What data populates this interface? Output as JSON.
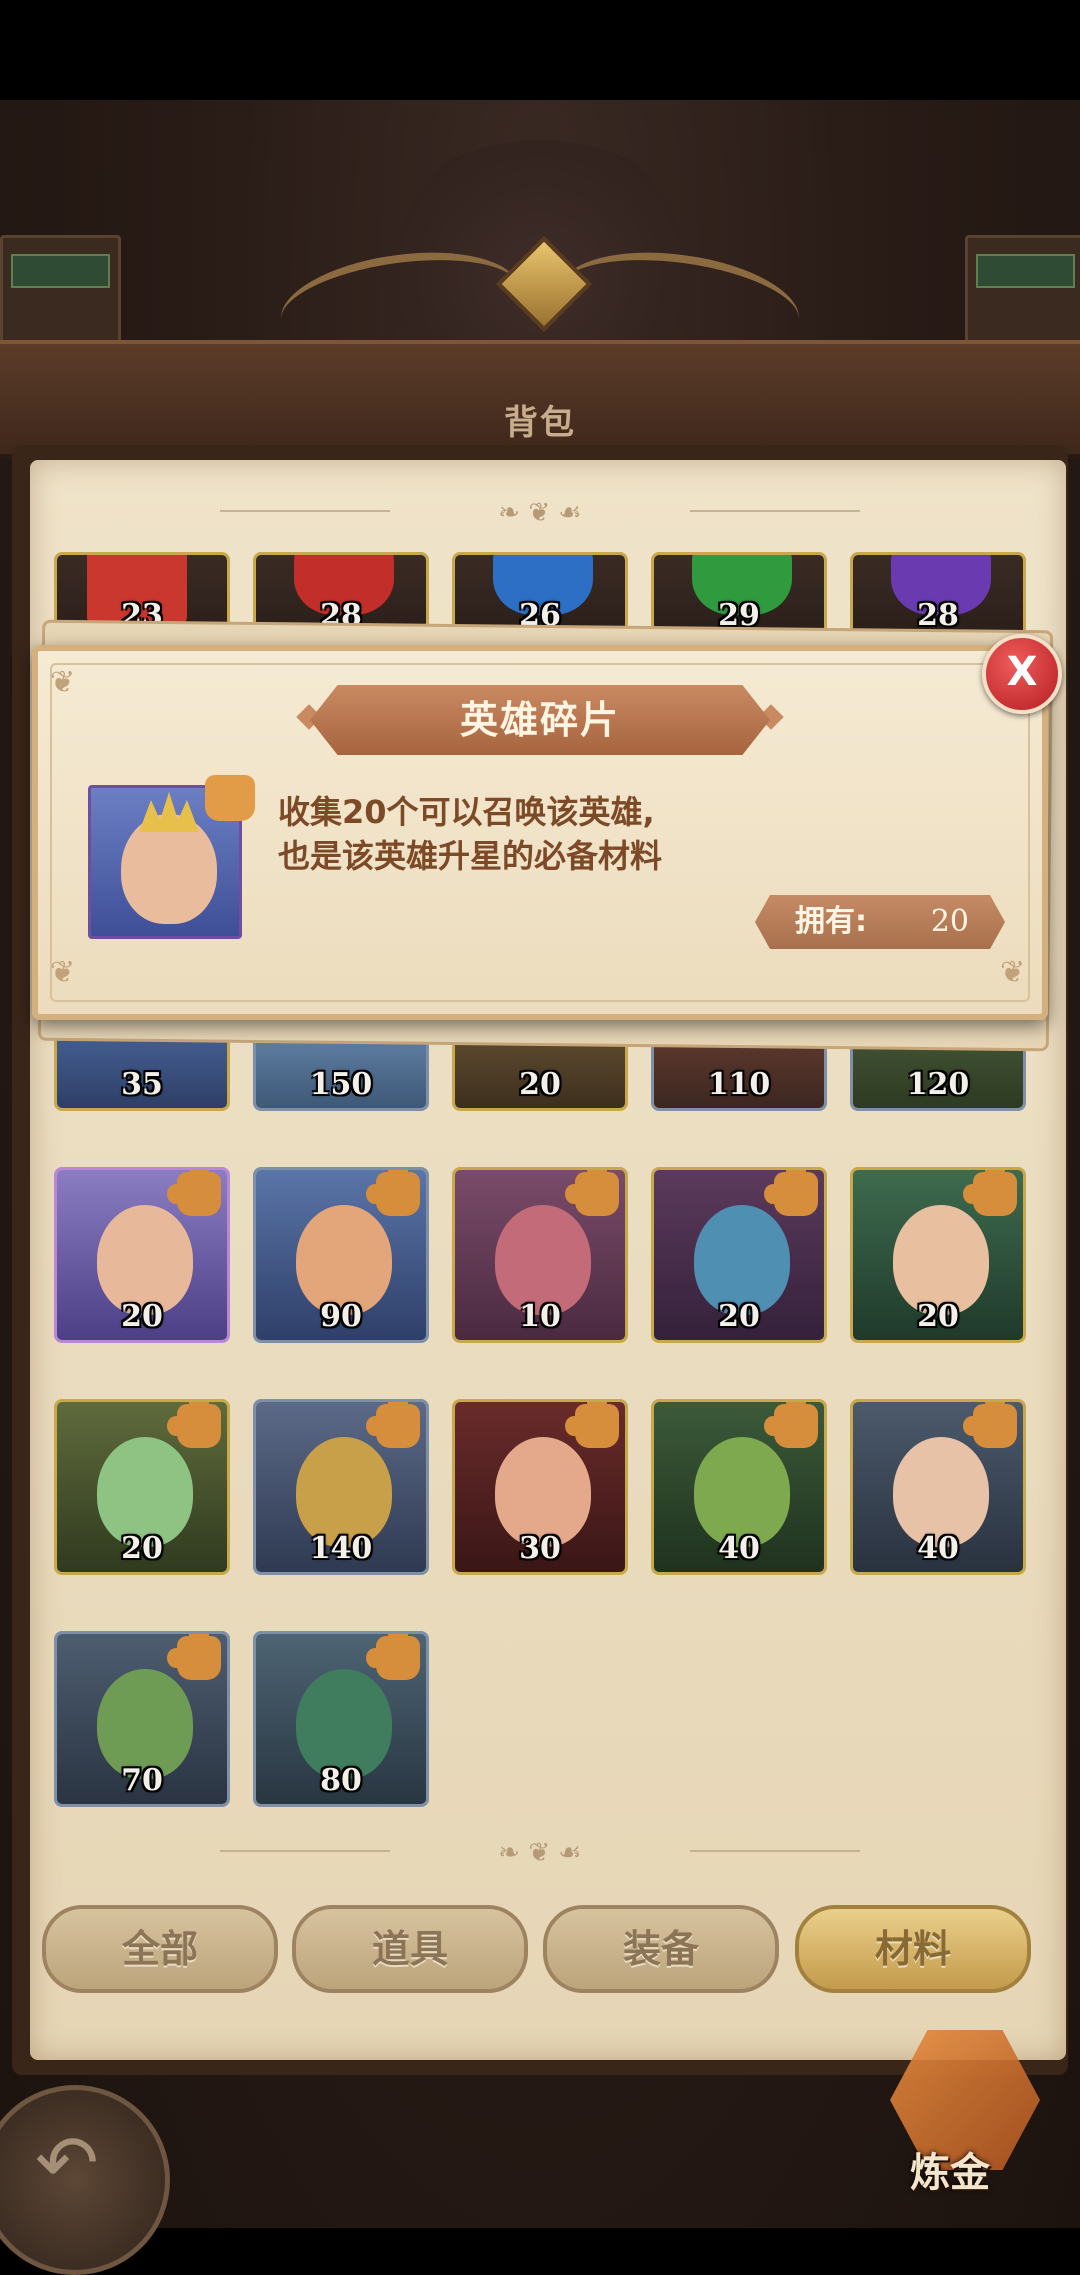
{
  "header": {
    "title": "背包"
  },
  "grid": {
    "row1": [
      {
        "count": "23",
        "kind": "red-scroll",
        "border": "gold"
      },
      {
        "count": "28",
        "kind": "red-gem",
        "border": "gold"
      },
      {
        "count": "26",
        "kind": "blue-gem",
        "border": "gold"
      },
      {
        "count": "29",
        "kind": "green-gem",
        "border": "gold"
      },
      {
        "count": "28",
        "kind": "purple-gem",
        "border": "gold"
      }
    ],
    "row2": [
      {
        "count": "35",
        "border": "gold"
      },
      {
        "count": "150",
        "border": "blue"
      },
      {
        "count": "20",
        "border": "gold"
      },
      {
        "count": "110",
        "border": "blue"
      },
      {
        "count": "120",
        "border": "blue"
      }
    ],
    "row3": [
      {
        "count": "20",
        "border": "purple"
      },
      {
        "count": "90",
        "border": "blue"
      },
      {
        "count": "10",
        "border": "gold"
      },
      {
        "count": "20",
        "border": "gold"
      },
      {
        "count": "20",
        "border": "gold"
      }
    ],
    "row4": [
      {
        "count": "20",
        "border": "gold"
      },
      {
        "count": "140",
        "border": "blue"
      },
      {
        "count": "30",
        "border": "gold"
      },
      {
        "count": "40",
        "border": "gold"
      },
      {
        "count": "40",
        "border": "gold"
      }
    ],
    "row5": [
      {
        "count": "70",
        "border": "blue"
      },
      {
        "count": "80",
        "border": "blue"
      }
    ]
  },
  "tabs": [
    {
      "label": "全部"
    },
    {
      "label": "道具"
    },
    {
      "label": "装备"
    },
    {
      "label": "材料",
      "active": true
    }
  ],
  "alchemy": {
    "label": "炼金"
  },
  "modal": {
    "title": "英雄碎片",
    "desc_line1": "收集20个可以召唤该英雄,",
    "desc_line2": "也是该英雄升星的必备材料",
    "own_label": "拥有:",
    "own_value": "20",
    "close_label": "X"
  },
  "colors": {
    "parchment": "#efe3c9",
    "header": "#5c3c28",
    "accent_red": "#b41e23",
    "text_brown": "#7d4a28"
  }
}
